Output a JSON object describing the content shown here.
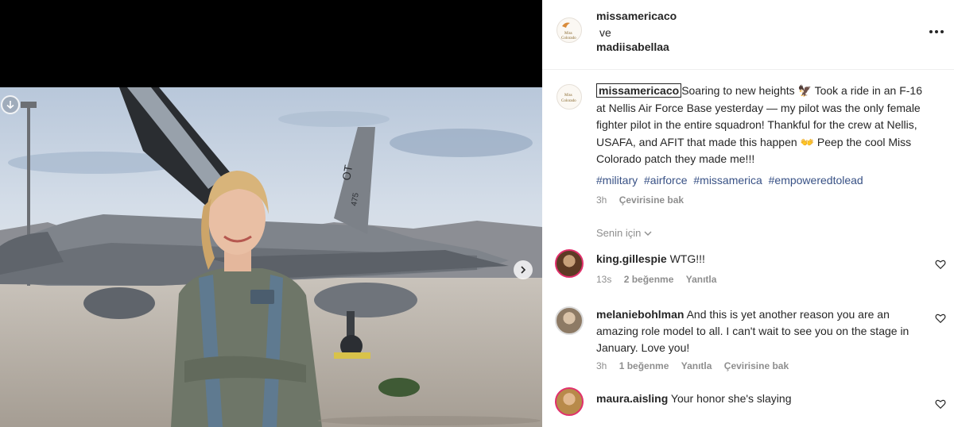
{
  "post": {
    "header": {
      "author1": "missamericaco",
      "conjunction": "ve",
      "author2": "madiisabellaa"
    },
    "avatar_text": {
      "line1": "Miss",
      "line2": "Colorado"
    },
    "caption": {
      "username": "missamericaco",
      "text": "Soaring to new heights 🦅 Took a ride in an F-16 at Nellis Air Force Base yesterday — my pilot was the only female fighter pilot in the entire squadron! Thankful for the crew at Nellis, USAFA, and AFIT that made this happen 👐 Peep the cool Miss Colorado patch they made me!!!",
      "hashtags": [
        "#military",
        "#airforce",
        "#missamerica",
        "#empoweredtolead"
      ],
      "time": "3h",
      "translate": "Çevirisine bak"
    },
    "comments_sort": "Senin için",
    "comments": [
      {
        "username": "king.gillespie",
        "text": "WTG!!!",
        "time": "13s",
        "likes": "2 beğenme",
        "reply": "Yanıtla",
        "translate": ""
      },
      {
        "username": "melaniebohlman",
        "text": "And this is yet another reason you are an amazing role model to all. I can't wait to see you on the stage in January. Love you!",
        "time": "3h",
        "likes": "1 beğenme",
        "reply": "Yanıtla",
        "translate": "Çevirisine bak"
      },
      {
        "username": "maura.aisling",
        "text": "Your honor she's slaying",
        "time": "",
        "likes": "",
        "reply": "",
        "translate": ""
      }
    ],
    "media_tail": {
      "code": "OT",
      "serial": "475"
    },
    "icons": {
      "download": "arrow-down-circle-icon",
      "next": "chevron-right-icon",
      "more": "more-horizontal-icon",
      "heart": "heart-icon",
      "sort": "chevron-down-icon"
    },
    "colors": {
      "text": "#262626",
      "muted": "#8e8e8e",
      "hashtag": "#385185",
      "story_ring": "#e1306c"
    }
  }
}
